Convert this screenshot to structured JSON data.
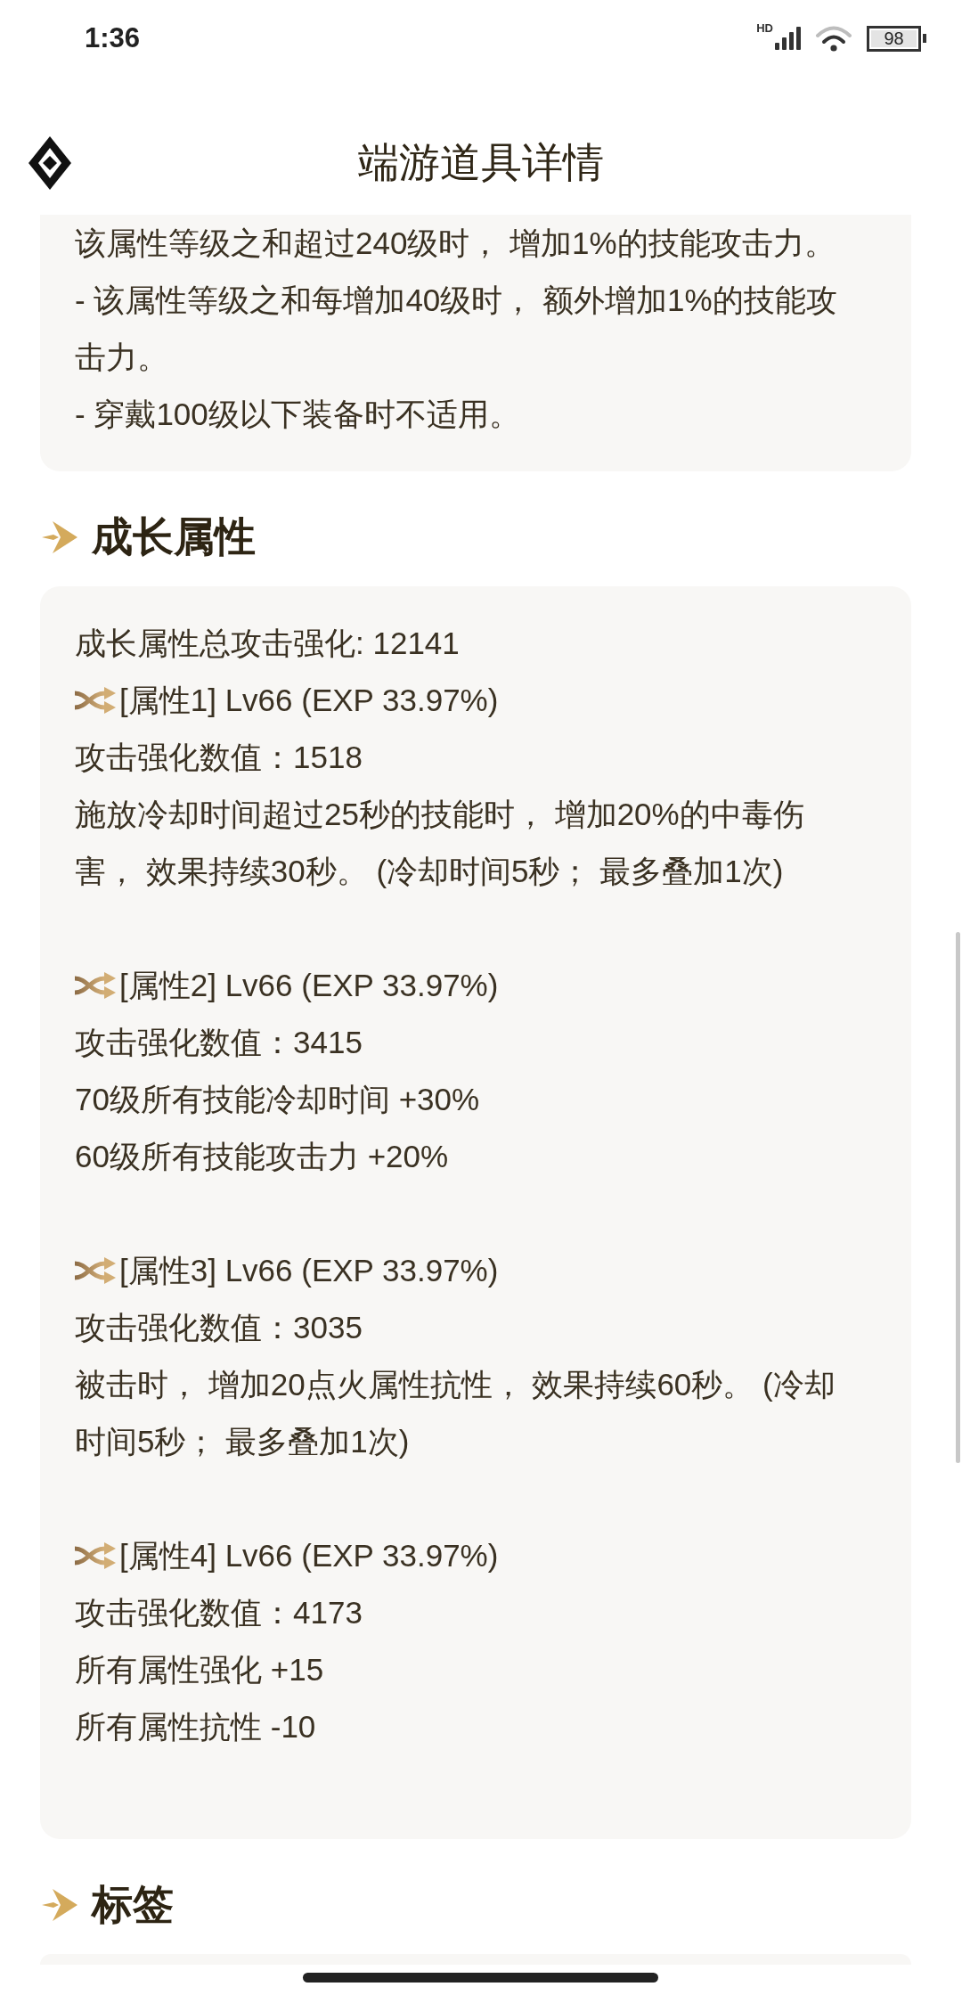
{
  "status_bar": {
    "time": "1:36",
    "network_type": "HD",
    "battery": "98"
  },
  "header": {
    "title": "端游道具详情"
  },
  "description_card": {
    "paragraphs": [
      "该属性等级之和超过240级时， 增加1%的技能攻击力。",
      "- 该属性等级之和每增加40级时， 额外增加1%的技能攻击力。",
      "- 穿戴100级以下装备时不适用。"
    ]
  },
  "sections": [
    {
      "title": "成长属性",
      "summary": "成长属性总攻击强化: 12141",
      "attributes": [
        {
          "name": "[属性1] Lv66 (EXP 33.97%)",
          "lines": [
            "攻击强化数值：1518",
            "施放冷却时间超过25秒的技能时， 增加20%的中毒伤害， 效果持续30秒。 (冷却时间5秒； 最多叠加1次)"
          ]
        },
        {
          "name": "[属性2] Lv66 (EXP 33.97%)",
          "lines": [
            "攻击强化数值：3415",
            "70级所有技能冷却时间 +30%",
            "60级所有技能攻击力 +20%"
          ]
        },
        {
          "name": "[属性3] Lv66 (EXP 33.97%)",
          "lines": [
            "攻击强化数值：3035",
            "被击时， 增加20点火属性抗性， 效果持续60秒。 (冷却时间5秒； 最多叠加1次)"
          ]
        },
        {
          "name": "[属性4] Lv66 (EXP 33.97%)",
          "lines": [
            "攻击强化数值：4173",
            "所有属性强化 +15",
            "所有属性抗性 -10"
          ]
        }
      ]
    },
    {
      "title": "标签"
    }
  ]
}
